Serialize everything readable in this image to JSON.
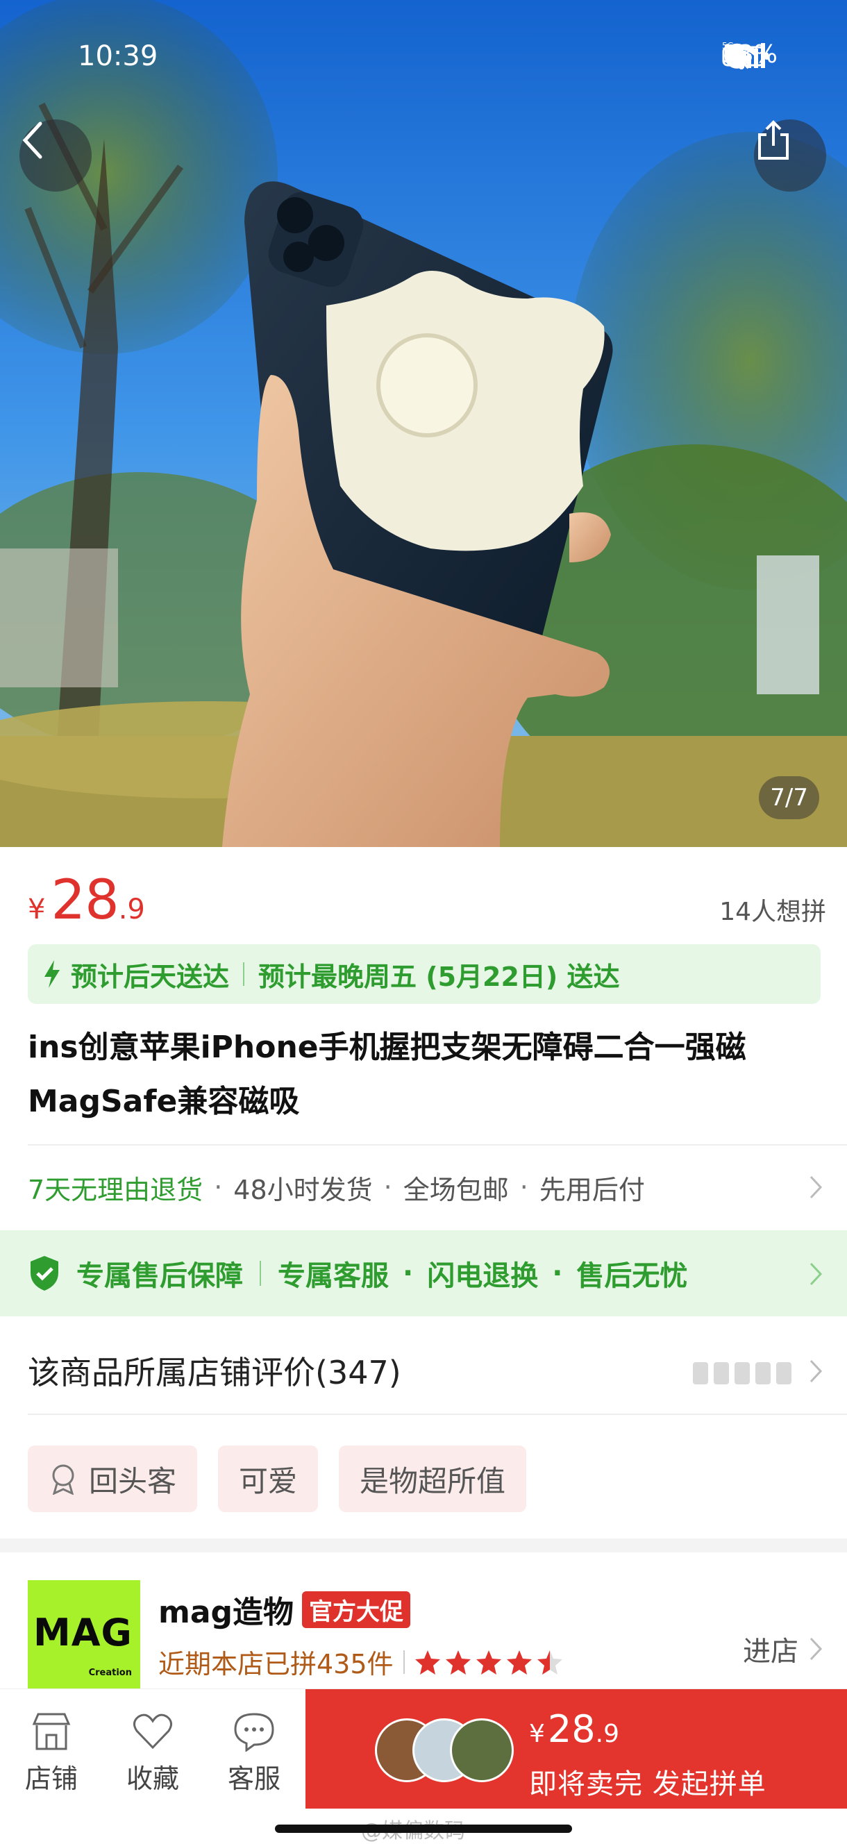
{
  "status_bar": {
    "time": "10:39",
    "network": "5G",
    "battery": "53%"
  },
  "hero": {
    "counter": "7/7"
  },
  "price": {
    "currency": "¥",
    "integer": "28",
    "decimal": ".9",
    "want_count": "14人想拼"
  },
  "delivery": {
    "primary": "预计后天送达",
    "secondary": "预计最晚周五 (5月22日) 送达"
  },
  "product_title": "ins创意苹果iPhone手机握把支架无障碍二合一强磁MagSafe兼容磁吸",
  "services": {
    "return": "7天无理由退货",
    "items": [
      "48小时发货",
      "全场包邮",
      "先用后付"
    ]
  },
  "guarantee": {
    "label": "专属售后保障",
    "items": [
      "专属客服",
      "闪电退换",
      "售后无忧"
    ]
  },
  "reviews": {
    "label": "该商品所属店铺评价(347)"
  },
  "review_tags": [
    "回头客",
    "可爱",
    "是物超所值"
  ],
  "store": {
    "logo_text": "MAG",
    "logo_sub": "Creation",
    "name": "mag造物",
    "badge": "官方大促",
    "sales": "近期本店已拼435件",
    "rating_stars": 4.5,
    "enter": "进店"
  },
  "bottom_nav": [
    {
      "label": "店铺",
      "icon": "store-icon"
    },
    {
      "label": "收藏",
      "icon": "heart-icon"
    },
    {
      "label": "客服",
      "icon": "chat-icon"
    }
  ],
  "buy": {
    "currency": "¥",
    "integer": "28",
    "decimal": ".9",
    "label": "即将卖完 发起拼单"
  },
  "watermark": "@媒偏数码",
  "colors": {
    "price_red": "#e0322c",
    "green": "#2e9c2f",
    "buy_red": "#e3352e"
  }
}
